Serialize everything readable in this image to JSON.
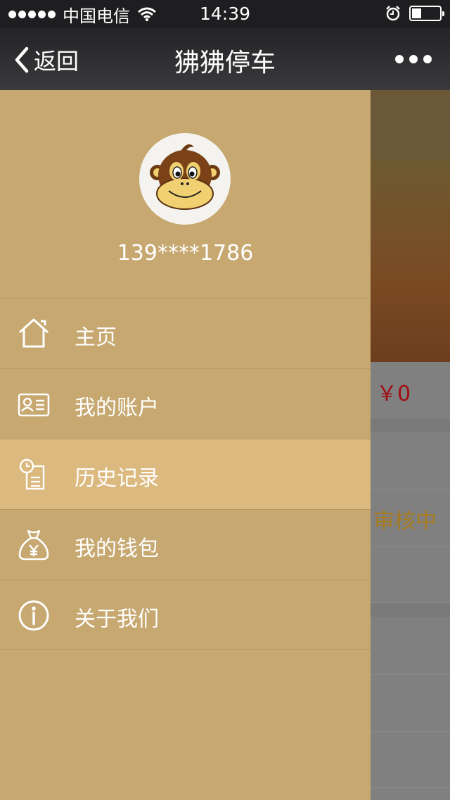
{
  "status_bar": {
    "carrier": "中国电信",
    "time": "14:39",
    "battery_level": 0.35
  },
  "nav": {
    "back_label": "返回",
    "title": "狒狒停车"
  },
  "profile": {
    "phone": "139****1786"
  },
  "menu": [
    {
      "label": "主页",
      "icon": "home-icon"
    },
    {
      "label": "我的账户",
      "icon": "id-card-icon"
    },
    {
      "label": "历史记录",
      "icon": "history-icon",
      "active": true
    },
    {
      "label": "我的钱包",
      "icon": "money-bag-icon"
    },
    {
      "label": "关于我们",
      "icon": "info-icon"
    }
  ],
  "background_page": {
    "price": "￥0",
    "status": "审核中"
  },
  "colors": {
    "drawer": "#c6a870",
    "active_item": "#dcb97f",
    "price": "#a00e14",
    "status": "#a57b22"
  }
}
